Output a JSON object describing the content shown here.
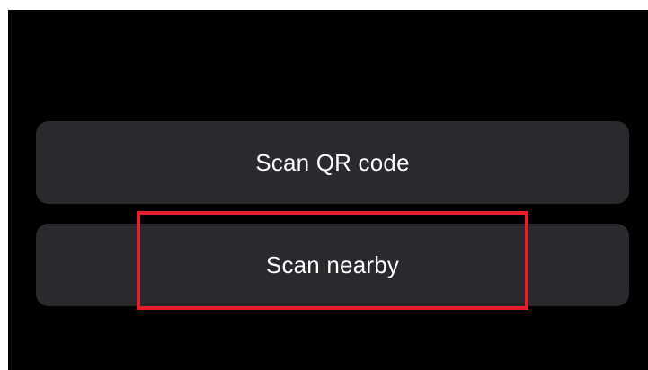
{
  "actions": {
    "scan_qr_label": "Scan QR code",
    "scan_nearby_label": "Scan nearby"
  },
  "colors": {
    "screen_background": "#000000",
    "button_background": "#2a2a2c",
    "button_text": "#ffffff",
    "highlight": "#e5202a"
  }
}
